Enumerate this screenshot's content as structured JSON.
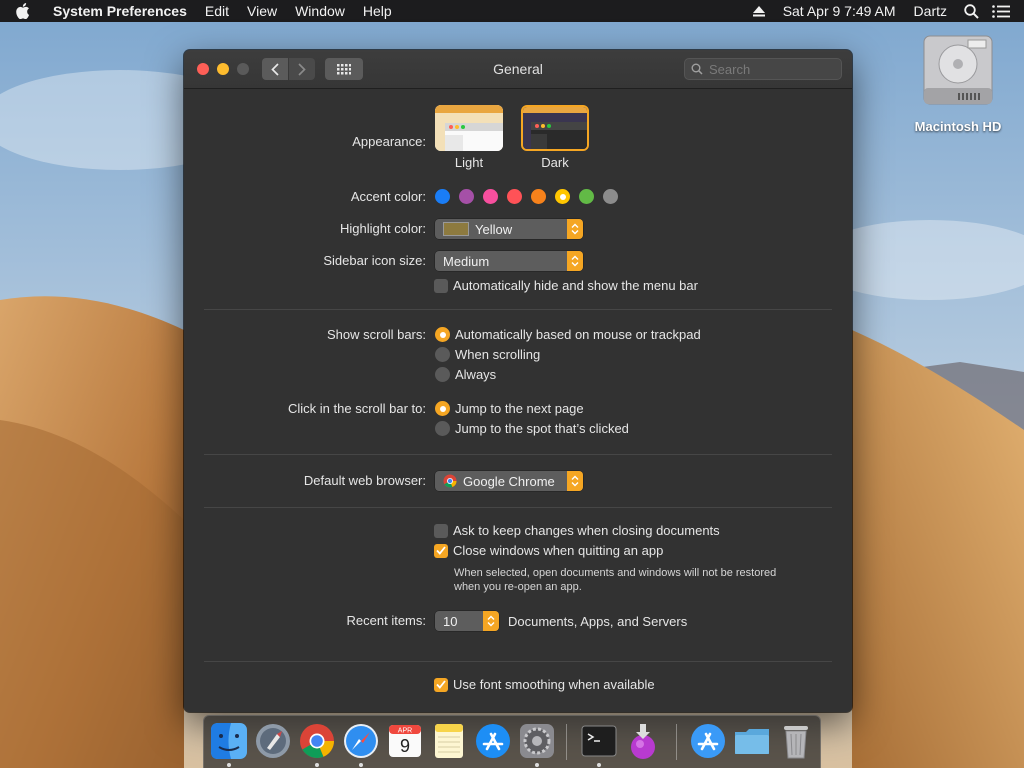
{
  "menubar": {
    "app_name": "System Preferences",
    "menus": [
      "Edit",
      "View",
      "Window",
      "Help"
    ],
    "clock": "Sat Apr 9  7:49 AM",
    "user": "Dartz"
  },
  "desktop": {
    "hd_label": "Macintosh HD"
  },
  "window": {
    "title": "General",
    "search_placeholder": "Search"
  },
  "general": {
    "appearance": {
      "label": "Appearance:",
      "options": [
        "Light",
        "Dark"
      ],
      "selected": "Dark"
    },
    "accent_color": {
      "label": "Accent color:",
      "colors": [
        "#1a7df6",
        "#a550a7",
        "#f74f9e",
        "#ff5257",
        "#f7821b",
        "#ffc600",
        "#62ba46",
        "#8c8c8c"
      ],
      "selected_index": 5
    },
    "highlight_color": {
      "label": "Highlight color:",
      "value": "Yellow",
      "swatch": "#8d7a3f"
    },
    "sidebar_icon_size": {
      "label": "Sidebar icon size:",
      "value": "Medium"
    },
    "auto_hide_menu_bar": {
      "label": "Automatically hide and show the menu bar",
      "checked": false
    },
    "scroll_bars": {
      "label": "Show scroll bars:",
      "options": [
        "Automatically based on mouse or trackpad",
        "When scrolling",
        "Always"
      ],
      "selected_index": 0
    },
    "click_scroll_bar": {
      "label": "Click in the scroll bar to:",
      "options": [
        "Jump to the next page",
        "Jump to the spot that’s clicked"
      ],
      "selected_index": 0
    },
    "default_browser": {
      "label": "Default web browser:",
      "value": "Google Chrome"
    },
    "ask_keep_changes": {
      "label": "Ask to keep changes when closing documents",
      "checked": false
    },
    "close_windows": {
      "label": "Close windows when quitting an app",
      "checked": true
    },
    "close_windows_note": {
      "line1": "When selected, open documents and windows will not be restored",
      "line2": "when you re-open an app."
    },
    "recent_items": {
      "label": "Recent items:",
      "value": "10",
      "suffix": "Documents, Apps, and Servers"
    },
    "font_smoothing": {
      "label": "Use font smoothing when available",
      "checked": true
    },
    "help": "?"
  },
  "dock": {
    "items": [
      "finder-icon",
      "launchpad-icon",
      "chrome-icon",
      "safari-icon",
      "calendar-icon",
      "notes-icon",
      "app-store-icon",
      "system-preferences-icon",
      "terminal-icon",
      "installer-icon",
      "app-store-folder-icon",
      "folder-icon",
      "trash-icon"
    ],
    "calendar": {
      "month": "APR",
      "day": "9"
    },
    "accent": "#f5a623"
  }
}
